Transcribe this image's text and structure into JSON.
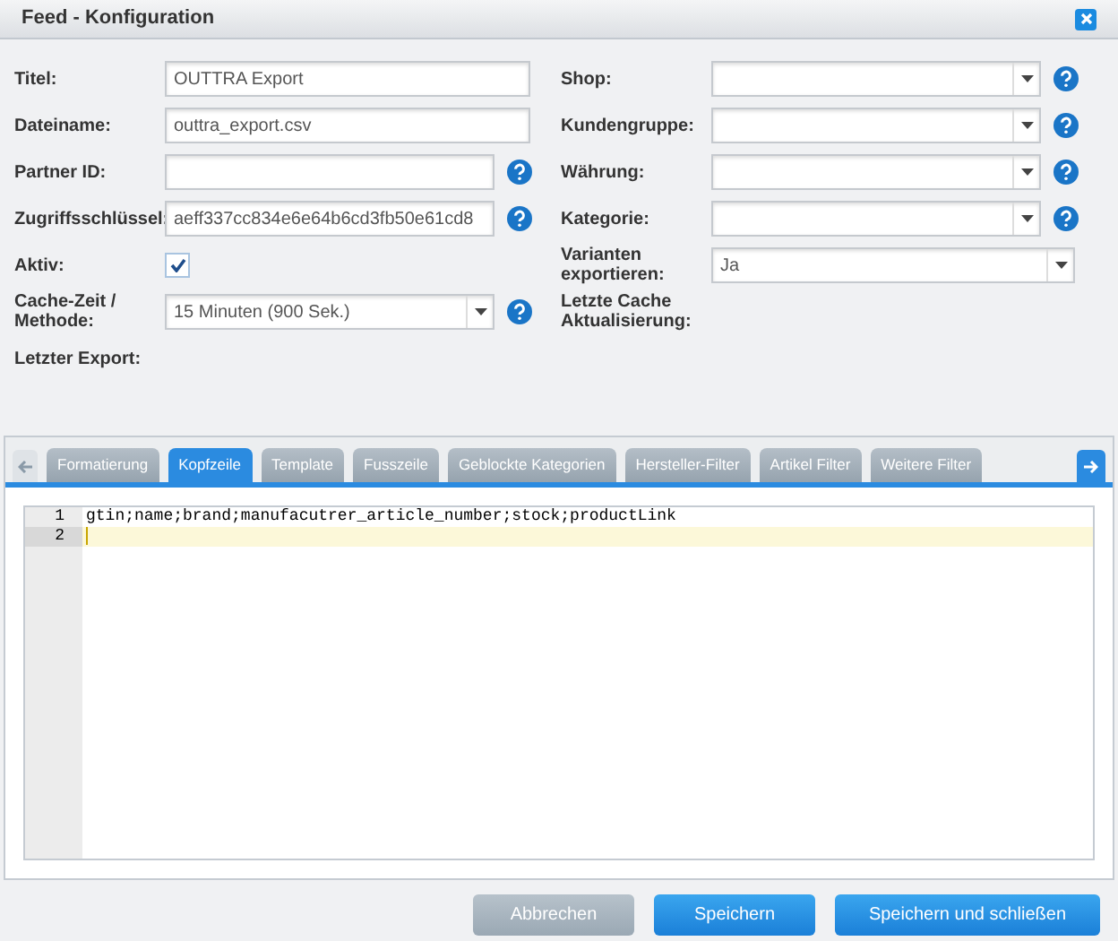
{
  "window": {
    "title": "Feed - Konfiguration"
  },
  "left_fields": [
    {
      "label": "Titel:",
      "kind": "text",
      "value": "OUTTRA Export",
      "help": false
    },
    {
      "label": "Dateiname:",
      "kind": "text",
      "value": "outtra_export.csv",
      "help": false
    },
    {
      "label": "Partner ID:",
      "kind": "text",
      "help": true
    },
    {
      "label": "Zugriffsschlüssel:",
      "kind": "text",
      "value": "aeff337cc834e6e64b6cd3fb50e61cd8",
      "help": true
    },
    {
      "label": "Aktiv:",
      "kind": "checkbox",
      "checked": true,
      "help": false
    },
    {
      "label": "Cache-Zeit / Methode:",
      "kind": "select",
      "value": "15 Minuten (900 Sek.)",
      "help": true
    },
    {
      "label": "Letzter Export:",
      "kind": "info"
    }
  ],
  "right_fields": [
    {
      "label": "Shop:",
      "kind": "select",
      "help": true
    },
    {
      "label": "Kundengruppe:",
      "kind": "select",
      "help": true
    },
    {
      "label": "Währung:",
      "kind": "select",
      "help": true
    },
    {
      "label": "Kategorie:",
      "kind": "select",
      "help": true
    },
    {
      "label": "Varianten exportieren:",
      "kind": "select",
      "value": "Ja",
      "help": false
    },
    {
      "label": "Letzte Cache Aktualisierung:",
      "kind": "info"
    }
  ],
  "tabs": [
    {
      "label": "Formatierung",
      "selected": false
    },
    {
      "label": "Kopfzeile",
      "selected": true
    },
    {
      "label": "Template",
      "selected": false
    },
    {
      "label": "Fusszeile",
      "selected": false
    },
    {
      "label": "Geblockte Kategorien",
      "selected": false
    },
    {
      "label": "Hersteller-Filter",
      "selected": false
    },
    {
      "label": "Artikel Filter",
      "selected": false
    },
    {
      "label": "Weitere Filter",
      "selected": false
    }
  ],
  "editor": {
    "lines": [
      {
        "number": "1",
        "text": "gtin;name;brand;manufacutrer_article_number;stock;productLink",
        "selected": false
      },
      {
        "number": "2",
        "selected": true
      }
    ]
  },
  "buttons": [
    {
      "label": "Abbrechen",
      "kind": "secondary"
    },
    {
      "label": "Speichern",
      "kind": "primary"
    },
    {
      "label": "Speichern und schließen",
      "kind": "primary"
    }
  ]
}
